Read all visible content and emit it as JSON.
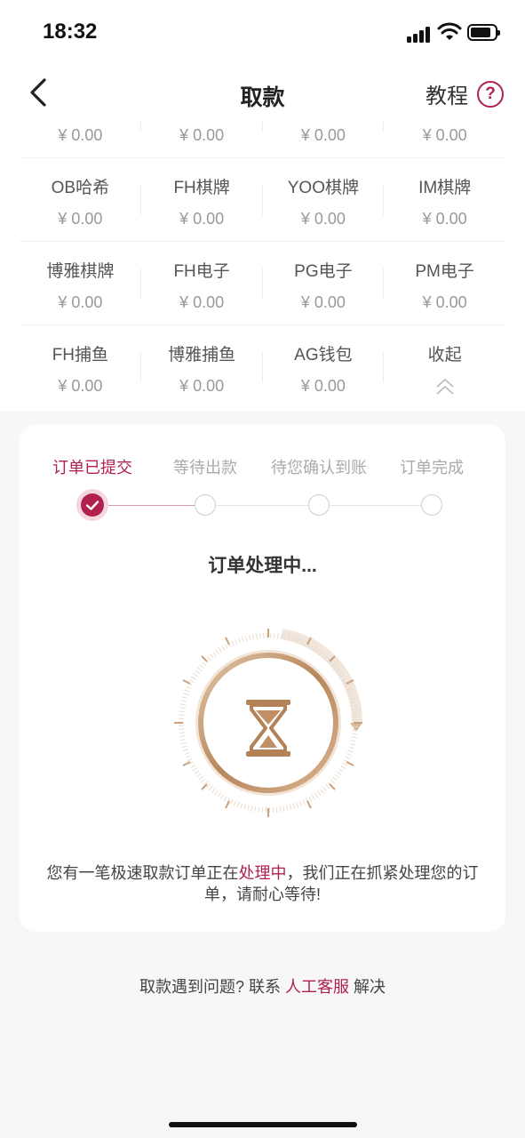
{
  "status_bar": {
    "time": "18:32"
  },
  "header": {
    "title": "取款",
    "tutorial_label": "教程",
    "help_icon": "?"
  },
  "wallets": {
    "top_partial": [
      "¥ 0.00",
      "¥ 0.00",
      "¥ 0.00",
      "¥ 0.00"
    ],
    "rows": [
      [
        {
          "name": "OB哈希",
          "amount": "¥ 0.00"
        },
        {
          "name": "FH棋牌",
          "amount": "¥ 0.00"
        },
        {
          "name": "YOO棋牌",
          "amount": "¥ 0.00"
        },
        {
          "name": "IM棋牌",
          "amount": "¥ 0.00"
        }
      ],
      [
        {
          "name": "博雅棋牌",
          "amount": "¥ 0.00"
        },
        {
          "name": "FH电子",
          "amount": "¥ 0.00"
        },
        {
          "name": "PG电子",
          "amount": "¥ 0.00"
        },
        {
          "name": "PM电子",
          "amount": "¥ 0.00"
        }
      ],
      [
        {
          "name": "FH捕鱼",
          "amount": "¥ 0.00"
        },
        {
          "name": "博雅捕鱼",
          "amount": "¥ 0.00"
        },
        {
          "name": "AG钱包",
          "amount": "¥ 0.00"
        }
      ]
    ],
    "collapse_label": "收起"
  },
  "progress": {
    "steps": [
      "订单已提交",
      "等待出款",
      "待您确认到账",
      "订单完成"
    ],
    "current_step": 1,
    "status_title": "订单处理中...",
    "message_before": "您有一笔极速取款订单正在",
    "message_highlight": "处理中",
    "message_after": "，我们正在抓紧处理您的订单，请耐心等待!"
  },
  "footer": {
    "prefix": "取款遇到问题? 联系 ",
    "link": "人工客服",
    "suffix": " 解决"
  },
  "colors": {
    "accent": "#b0224d",
    "gold": "#c49a74"
  }
}
